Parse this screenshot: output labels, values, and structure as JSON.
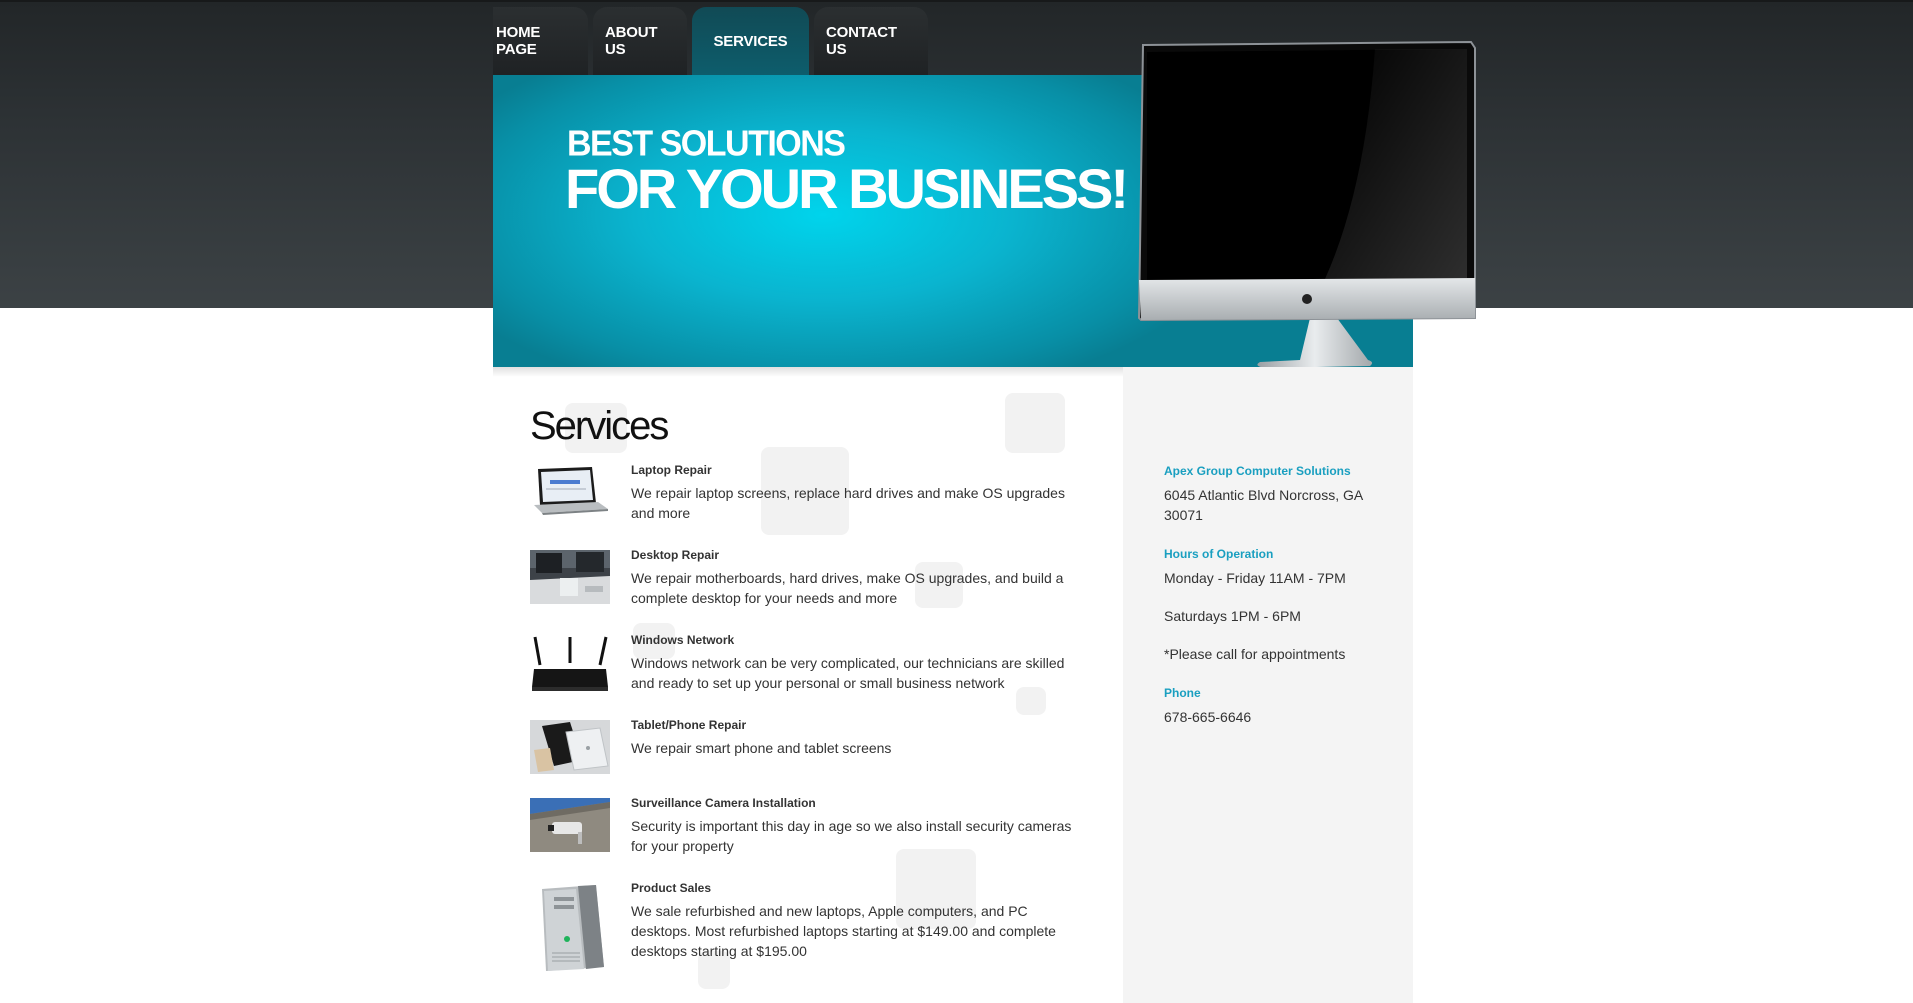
{
  "nav": {
    "items": [
      {
        "label": "HOME PAGE",
        "active": false
      },
      {
        "label": "ABOUT US",
        "active": false
      },
      {
        "label": "SERVICES",
        "active": true
      },
      {
        "label": "CONTACT US",
        "active": false
      }
    ]
  },
  "banner": {
    "line1": "BEST SOLUTIONS",
    "line2": "FOR YOUR BUSINESS!"
  },
  "main": {
    "title": "Services",
    "services": [
      {
        "title": "Laptop Repair",
        "description": "We repair laptop screens, replace hard drives and make OS upgrades and more",
        "icon": "laptop-icon"
      },
      {
        "title": "Desktop Repair",
        "description": "We repair motherboards, hard drives, make OS upgrades, and build a complete desktop for your needs and more",
        "icon": "desktop-icon"
      },
      {
        "title": "Windows Network",
        "description": "Windows network can be very complicated, our technicians are skilled and ready to set up your personal or small business network",
        "icon": "router-icon"
      },
      {
        "title": "Tablet/Phone Repair",
        "description": "We repair smart phone and tablet screens",
        "icon": "tablet-icon"
      },
      {
        "title": "Surveillance Camera Installation",
        "description": "Security is important this day in age so we also install security cameras for your property",
        "icon": "camera-icon"
      },
      {
        "title": "Product Sales",
        "description": "We sale refurbished and new laptops, Apple computers, and PC desktops. Most refurbished laptops starting at $149.00 and complete desktops starting at $195.00",
        "icon": "pc-tower-icon"
      }
    ]
  },
  "sidebar": {
    "company_heading": "Apex Group Computer Solutions",
    "address": "6045 Atlantic Blvd Norcross, GA 30071",
    "hours_heading": "Hours of Operation",
    "hours_weekday": "Monday - Friday 11AM - 7PM",
    "hours_saturday": "Saturdays 1PM - 6PM",
    "appointment_note": "*Please call for appointments",
    "phone_heading": "Phone",
    "phone": "678-665-6646"
  },
  "colors": {
    "accent": "#1a9fc0",
    "banner": "#0ab4cf",
    "header_dark": "#2d3235",
    "nav_active": "#0d5d6c",
    "sidebar_bg": "#f4f4f4"
  }
}
